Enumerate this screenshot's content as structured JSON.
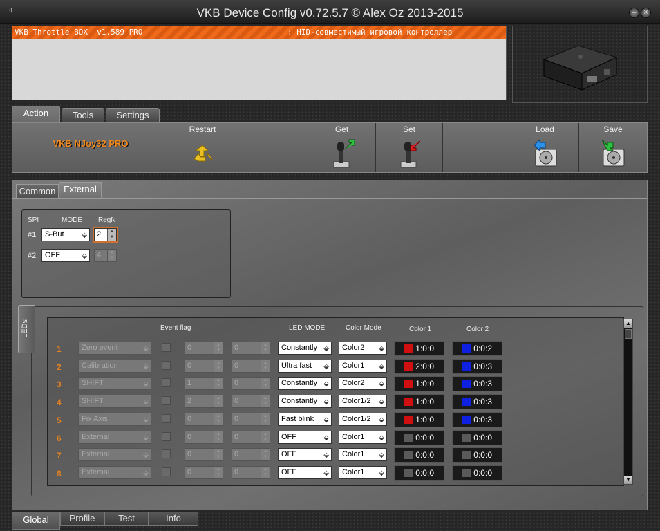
{
  "window": {
    "title": "VKB Device Config v0.72.5.7 © Alex Oz 2013-2015"
  },
  "console": {
    "device": "VKB Throttle BOX  v1.589 PRO",
    "description": ": HID-совместимый игровой контроллер"
  },
  "top_tabs": [
    "Action",
    "Tools",
    "Settings"
  ],
  "toolbar": {
    "device_name": "VKB NJoy32 PRO",
    "restart": "Restart",
    "get": "Get",
    "set": "Set",
    "load": "Load",
    "save": "Save"
  },
  "sub_tabs": [
    "Common",
    "External"
  ],
  "spi": {
    "col_spi": "SPI",
    "col_mode": "MODE",
    "col_regn": "RegN",
    "rows": [
      {
        "label": "#1",
        "mode": "S-But",
        "regn": "2"
      },
      {
        "label": "#2",
        "mode": "OFF",
        "regn": "4"
      }
    ]
  },
  "leds": {
    "tab_label": "LEDs",
    "headers": {
      "event_flag": "Event flag",
      "led_mode": "LED MODE",
      "color_mode": "Color Mode",
      "color1": "Color 1",
      "color2": "Color 2"
    },
    "rows": [
      {
        "num": "1",
        "event": "Zero event",
        "v1": "0",
        "v2": "0",
        "led_mode": "Constantly",
        "color_mode": "Color2",
        "c1": "1:0:0",
        "c1_color": "#d01010",
        "c2": "0:0:2",
        "c2_color": "#1020e0"
      },
      {
        "num": "2",
        "event": "Calibration",
        "v1": "0",
        "v2": "0",
        "led_mode": "Ultra fast",
        "color_mode": "Color1",
        "c1": "2:0:0",
        "c1_color": "#d01010",
        "c2": "0:0:3",
        "c2_color": "#1020e0"
      },
      {
        "num": "3",
        "event": "SHIFT",
        "v1": "1",
        "v2": "0",
        "led_mode": "Constantly",
        "color_mode": "Color2",
        "c1": "1:0:0",
        "c1_color": "#d01010",
        "c2": "0:0:3",
        "c2_color": "#1020e0"
      },
      {
        "num": "4",
        "event": "SHIFT",
        "v1": "2",
        "v2": "0",
        "led_mode": "Constantly",
        "color_mode": "Color1/2",
        "c1": "1:0:0",
        "c1_color": "#d01010",
        "c2": "0:0:3",
        "c2_color": "#1020e0"
      },
      {
        "num": "5",
        "event": "Fix Axis",
        "v1": "0",
        "v2": "0",
        "led_mode": "Fast blink",
        "color_mode": "Color1/2",
        "c1": "1:0:0",
        "c1_color": "#d01010",
        "c2": "0:0:3",
        "c2_color": "#1020e0"
      },
      {
        "num": "6",
        "event": "External",
        "v1": "0",
        "v2": "0",
        "led_mode": "OFF",
        "color_mode": "Color1",
        "c1": "0:0:0",
        "c1_color": "#5a5a5a",
        "c2": "0:0:0",
        "c2_color": "#5a5a5a"
      },
      {
        "num": "7",
        "event": "External",
        "v1": "0",
        "v2": "0",
        "led_mode": "OFF",
        "color_mode": "Color1",
        "c1": "0:0:0",
        "c1_color": "#5a5a5a",
        "c2": "0:0:0",
        "c2_color": "#5a5a5a"
      },
      {
        "num": "8",
        "event": "External",
        "v1": "0",
        "v2": "0",
        "led_mode": "OFF",
        "color_mode": "Color1",
        "c1": "0:0:0",
        "c1_color": "#5a5a5a",
        "c2": "0:0:0",
        "c2_color": "#5a5a5a"
      }
    ]
  },
  "bottom_tabs": [
    "Global",
    "Profile",
    "Test",
    "Info"
  ]
}
